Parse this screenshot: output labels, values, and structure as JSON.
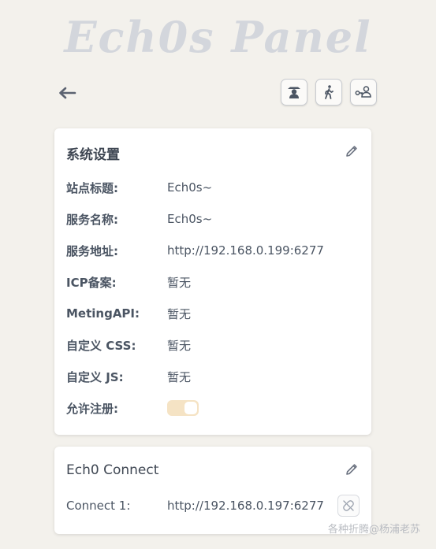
{
  "header": {
    "title": "Ech0s Panel"
  },
  "toolbar": {
    "back_icon": "arrow-left-icon",
    "buttons": [
      {
        "icon": "user-hat-icon"
      },
      {
        "icon": "walking-person-icon"
      },
      {
        "icon": "user-key-icon"
      }
    ]
  },
  "system_settings": {
    "title": "系统设置",
    "rows": [
      {
        "label": "站点标题:",
        "value": "Ech0s~"
      },
      {
        "label": "服务名称:",
        "value": "Ech0s~"
      },
      {
        "label": "服务地址:",
        "value": "http://192.168.0.199:6277"
      },
      {
        "label": "ICP备案:",
        "value": "暂无"
      },
      {
        "label": "MetingAPI:",
        "value": "暂无"
      },
      {
        "label": "自定义 CSS:",
        "value": "暂无"
      },
      {
        "label": "自定义 JS:",
        "value": "暂无"
      }
    ],
    "allow_register": {
      "label": "允许注册:",
      "enabled": true
    }
  },
  "connect": {
    "title": "Ech0 Connect",
    "items": [
      {
        "label": "Connect 1:",
        "value": "http://192.168.0.197:6277"
      }
    ]
  },
  "watermark": "各种折腾@杨浦老苏",
  "colors": {
    "background": "#f3f1ec",
    "title_text": "#d3d6dc",
    "toggle_track": "#f5e3c4",
    "card": "#ffffff"
  }
}
